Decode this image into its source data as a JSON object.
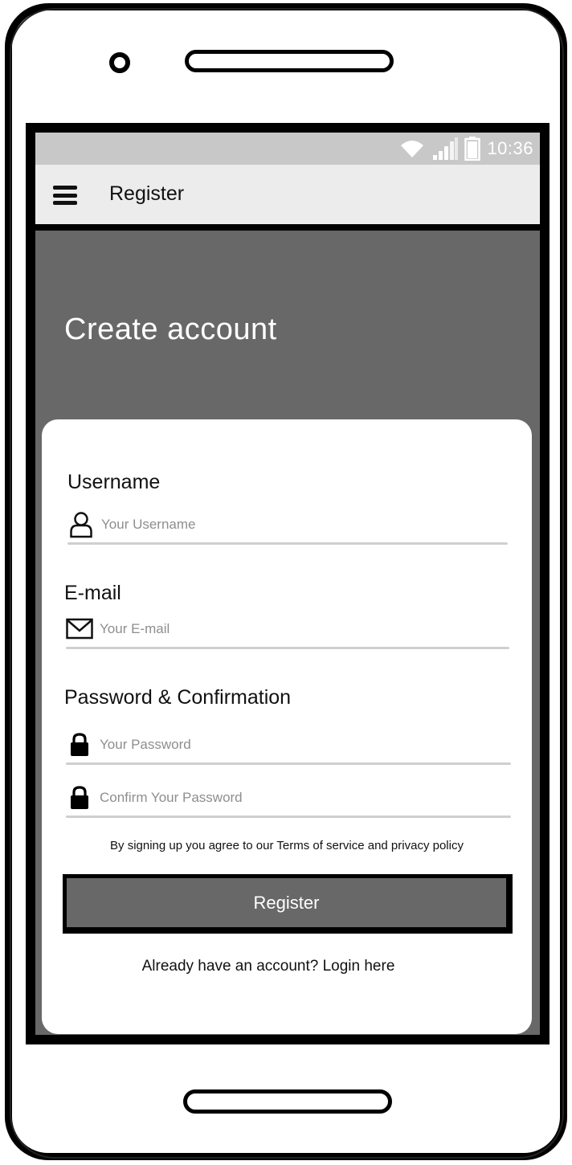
{
  "status_bar": {
    "time": "10:36",
    "icons": [
      "wifi-icon",
      "signal-icon",
      "battery-icon"
    ]
  },
  "app_bar": {
    "title": "Register",
    "menu_icon": "hamburger-menu-icon"
  },
  "hero": {
    "title": "Create account"
  },
  "form": {
    "username": {
      "label": "Username",
      "placeholder": "Your Username",
      "icon": "user-icon"
    },
    "email": {
      "label": "E-mail",
      "placeholder": "Your E-mail",
      "icon": "envelope-icon"
    },
    "password_section_label": "Password & Confirmation",
    "password": {
      "placeholder": "Your Password",
      "icon": "lock-icon"
    },
    "confirm_password": {
      "placeholder": "Confirm Your Password",
      "icon": "lock-icon"
    },
    "terms_text": "By signing up you agree to our Terms of service and privacy policy",
    "submit_label": "Register",
    "login_prompt": "Already have an account? Login here"
  },
  "colors": {
    "header_bg": "#686868",
    "status_bar_bg": "#c8c8c8",
    "app_bar_bg": "#ececec",
    "card_bg": "#ffffff",
    "underline": "#cfcfcf",
    "button_bg": "#686868"
  }
}
